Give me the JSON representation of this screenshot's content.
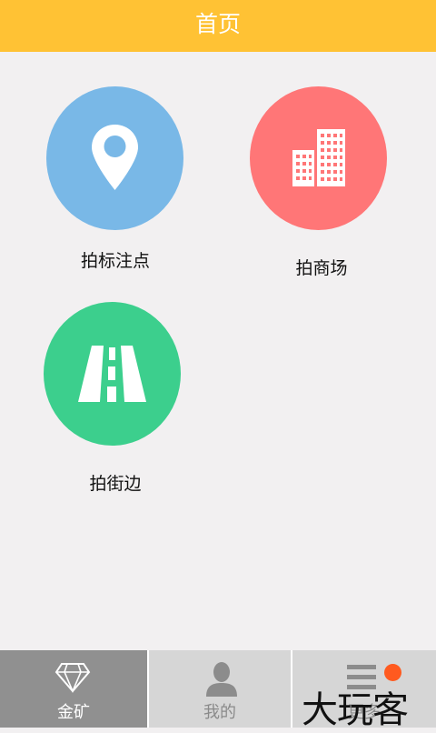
{
  "header": {
    "title": "首页"
  },
  "tiles": [
    {
      "label": "拍标注点",
      "icon": "location-pin-icon",
      "color": "#79b8e7"
    },
    {
      "label": "拍商场",
      "icon": "buildings-icon",
      "color": "#ff7677"
    },
    {
      "label": "拍街边",
      "icon": "road-icon",
      "color": "#3ccf8d"
    }
  ],
  "tabbar": {
    "tabs": [
      {
        "label": "金矿",
        "icon": "diamond-icon",
        "active": true
      },
      {
        "label": "我的",
        "icon": "user-icon",
        "active": false
      },
      {
        "label": "更多",
        "icon": "menu-icon",
        "active": false
      }
    ],
    "active_color": "#909090",
    "inactive_color": "#d6d6d6"
  },
  "watermark": {
    "text": "大玩客"
  }
}
